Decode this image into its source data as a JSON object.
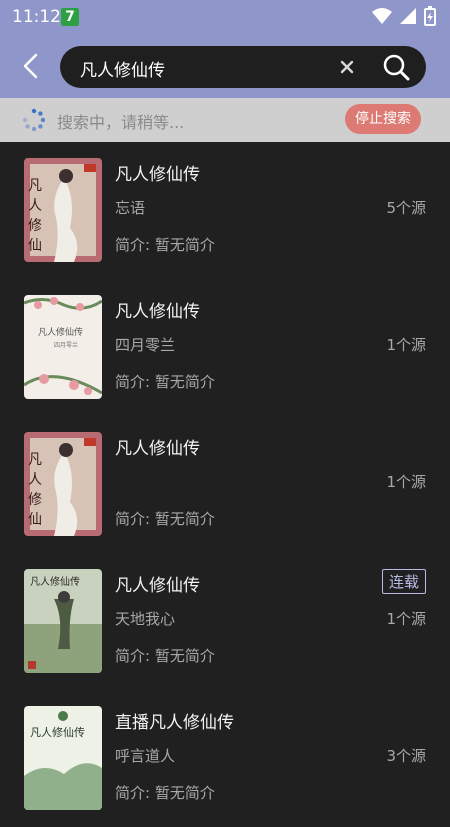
{
  "status": {
    "time": "11:12",
    "badge": "7"
  },
  "search": {
    "query": "凡人修仙传"
  },
  "progress": {
    "text": "搜索中，请稍等...",
    "stop_label": "停止搜索"
  },
  "results": [
    {
      "name": "凡人修仙传",
      "author": "忘语",
      "sources": "5个源",
      "intro": "简介: 暂无简介",
      "tag": ""
    },
    {
      "name": "凡人修仙传",
      "author": "四月零兰",
      "sources": "1个源",
      "intro": "简介: 暂无简介",
      "tag": ""
    },
    {
      "name": "凡人修仙传",
      "author": "",
      "sources": "1个源",
      "intro": "简介: 暂无简介",
      "tag": ""
    },
    {
      "name": "凡人修仙传",
      "author": "天地我心",
      "sources": "1个源",
      "intro": "简介: 暂无简介",
      "tag": "连载"
    },
    {
      "name": "直播凡人修仙传",
      "author": "呼言道人",
      "sources": "3个源",
      "intro": "简介: 暂无简介",
      "tag": ""
    }
  ],
  "colors": {
    "accent": "#8f96c9",
    "stop_button": "#dc7a73",
    "background": "#202020"
  }
}
